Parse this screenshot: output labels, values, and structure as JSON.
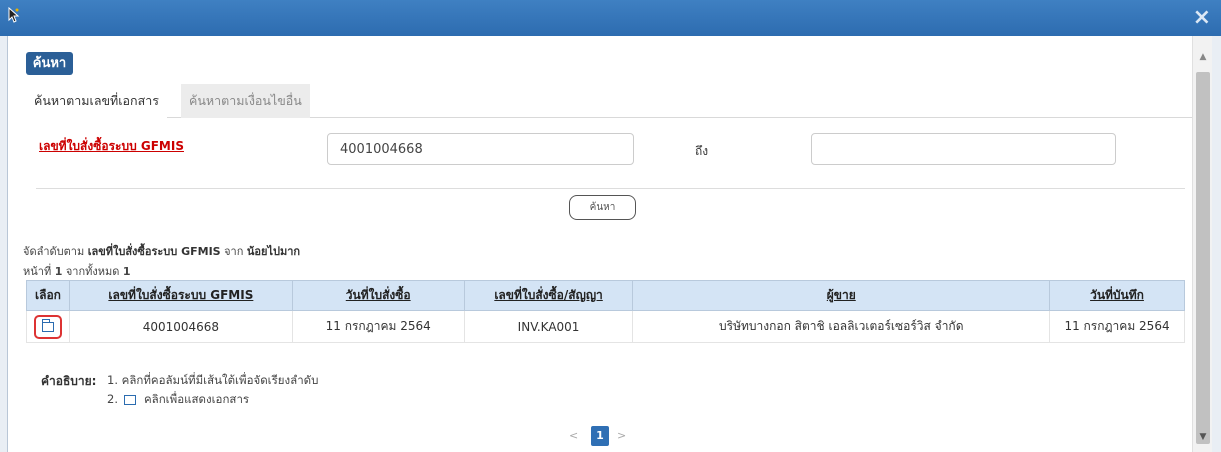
{
  "window": {
    "close_symbol": "×"
  },
  "search": {
    "badge": "ค้นหา",
    "tabs": [
      {
        "label": "ค้นหาตามเลขที่เอกสาร"
      },
      {
        "label": "ค้นหาตามเงื่อนไขอื่น"
      }
    ],
    "field_label": "เลขที่ใบสั่งซื้อระบบ GFMIS",
    "from_value": "4001004668",
    "to_label": "ถึง",
    "to_value": "",
    "button_label": "ค้นหา"
  },
  "results": {
    "sort_prefix": "จัดลำดับตาม ",
    "sort_field": "เลขที่ใบสั่งซื้อระบบ GFMIS",
    "sort_middle": " จาก ",
    "sort_order": "น้อยไปมาก",
    "page_prefix": "หน้าที่ ",
    "page_current": "1",
    "page_middle": " จากทั้งหมด ",
    "page_total": "1",
    "columns": [
      "เลือก",
      "เลขที่ใบสั่งซื้อระบบ GFMIS",
      "วันที่ใบสั่งซื้อ",
      "เลขที่ใบสั่งซื้อ/สัญญา",
      "ผู้ขาย",
      "วันที่บันทึก"
    ],
    "rows": [
      {
        "po_number": "4001004668",
        "po_date": "11 กรกฎาคม 2564",
        "contract_no": "INV.KA001",
        "vendor": "บริษัทบางกอก สิตาชิ เอลลิเวเตอร์เซอร์วิส จำกัด",
        "record_date": "11 กรกฎาคม 2564"
      }
    ]
  },
  "legend": {
    "title": "คำอธิบาย:",
    "item1": "1. คลิกที่คอลัมน์ที่มีเส้นใต้เพื่อจัดเรียงลำดับ",
    "item2_prefix": "2.",
    "item2_text": "คลิกเพื่อแสดงเอกสาร"
  },
  "pagination": {
    "prev": "<",
    "current": "1",
    "next": ">"
  },
  "colors": {
    "titlebar": "#3a78bb",
    "header_row": "#d4e4f5",
    "badge": "#2b5f97",
    "required_label": "#cc0000",
    "highlight": "#dd3333"
  }
}
